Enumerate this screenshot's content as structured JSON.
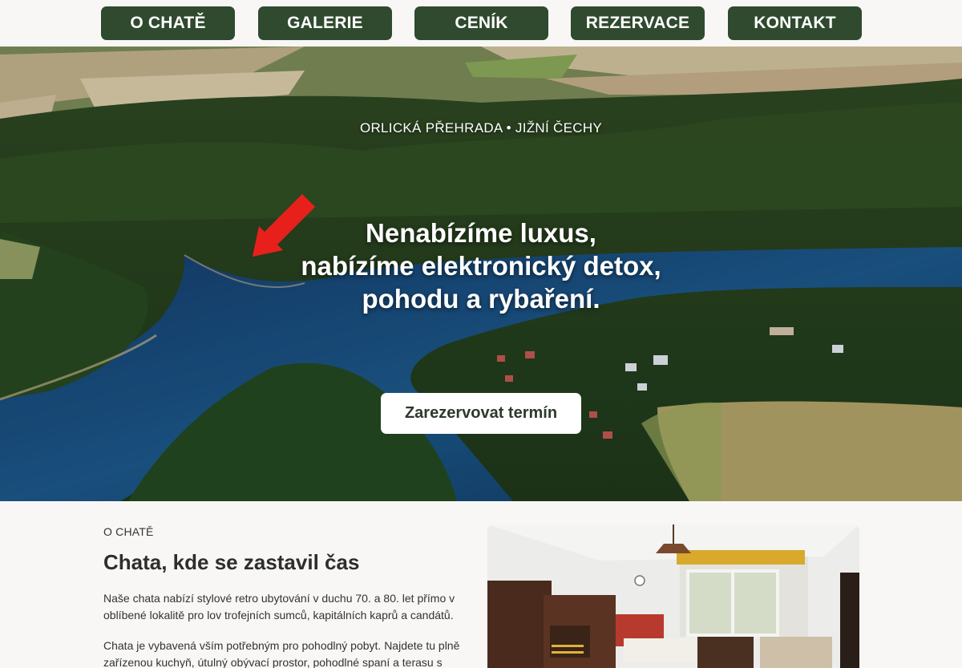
{
  "nav": {
    "items": [
      {
        "label": "O CHATĚ"
      },
      {
        "label": "GALERIE"
      },
      {
        "label": "CENÍK"
      },
      {
        "label": "REZERVACE"
      },
      {
        "label": "KONTAKT"
      }
    ]
  },
  "hero": {
    "kicker": "ORLICKÁ PŘEHRADA • JIŽNÍ ČECHY",
    "title_lines": [
      "Nenabízíme luxus,",
      "nabízíme elektronický detox,",
      "pohodu a rybaření."
    ],
    "cta_label": "Zarezervovat termín",
    "image": "aerial-lake-forest",
    "arrow_icon": "red-arrow-icon"
  },
  "about": {
    "kicker": "O CHATĚ",
    "title": "Chata, kde se zastavil čas",
    "p1": "Naše chata nabízí stylové retro ubytování v duchu 70. a 80. let přímo v oblíbené lokalitě pro lov trofejních sumců, kapitálních kaprů a candátů.",
    "p2": "Chata je vybavená vším potřebným pro pohodlný pobyt. Najdete tu plně zařízenou kuchyň, útulný obývací prostor, pohodlné spaní a terasu s výhledem",
    "image": "retro-living-room"
  },
  "colors": {
    "nav_bg": "#2f4a2e",
    "page_bg": "#f8f7f5",
    "cta_bg": "#ffffff",
    "arrow": "#e8201c"
  }
}
